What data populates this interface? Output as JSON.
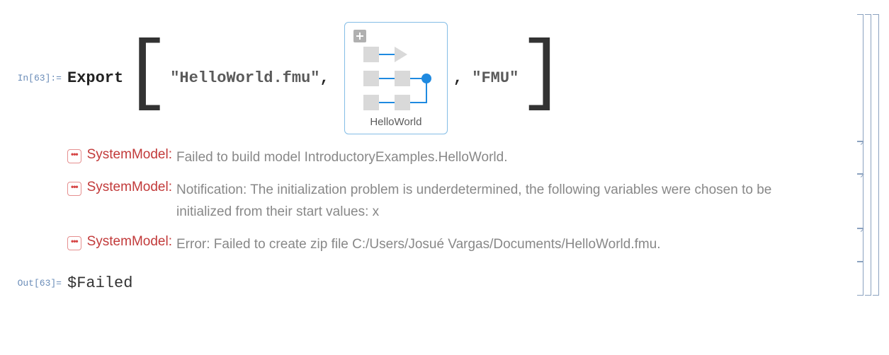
{
  "input": {
    "label": "In[63]:=",
    "fn": "Export",
    "arg1": "\"HelloWorld.fmu\"",
    "arg3": "\"FMU\"",
    "model_caption": "HelloWorld"
  },
  "messages": [
    {
      "tag": "SystemModel",
      "text": "Failed to build model IntroductoryExamples.HelloWorld."
    },
    {
      "tag": "SystemModel",
      "text": "Notification: The initialization problem is underdetermined, the following variables were chosen to be initialized from their start values: x"
    },
    {
      "tag": "SystemModel",
      "text": "Error: Failed to create zip file C:/Users/Josué Vargas/Documents/HelloWorld.fmu."
    }
  ],
  "output": {
    "label": "Out[63]=",
    "value": "$Failed"
  }
}
